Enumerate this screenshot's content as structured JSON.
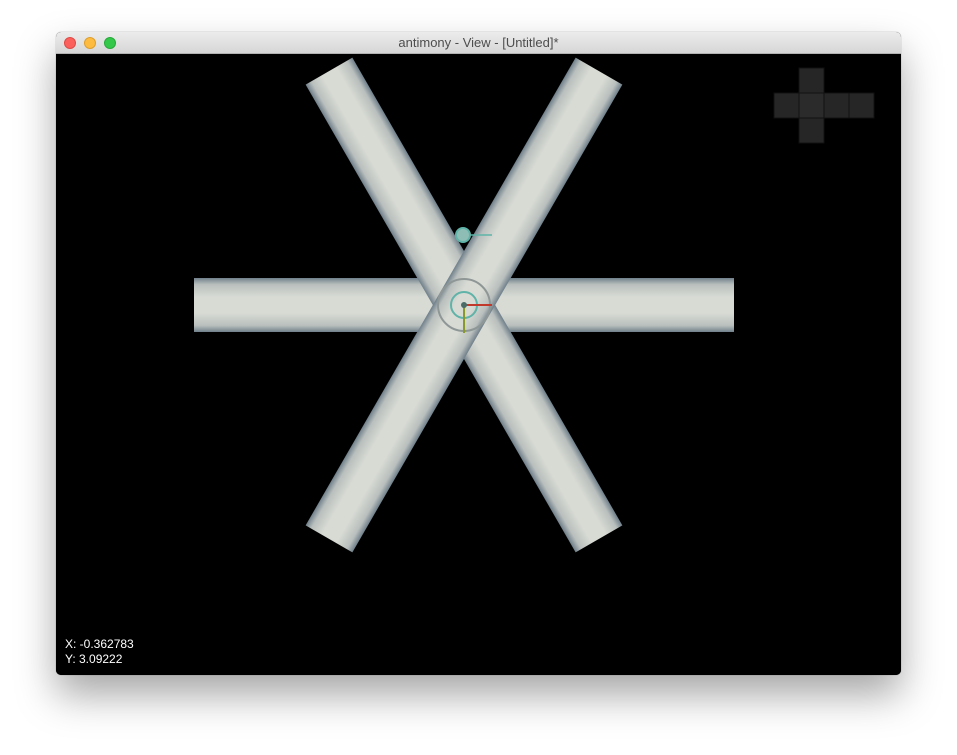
{
  "window": {
    "title": "antimony - View - [Untitled]*"
  },
  "viewport": {
    "background": "#000000",
    "shape_color": "#d4d7d0",
    "shape_edge_color": "#6f7f8a",
    "coordinates": {
      "x_label": "X: -0.362783",
      "y_label": "Y: 3.09222"
    }
  },
  "colors": {
    "close": "#fc605c",
    "minimize": "#fdbc40",
    "maximize": "#34c84a",
    "axis_x": "#c0392b",
    "axis_y": "#8a9a2a",
    "handle": "#5fb3a8"
  },
  "icons": {
    "view_cube": "view-orientation-cross-icon",
    "origin": "origin-handle-icon",
    "control_point": "control-point-icon"
  }
}
